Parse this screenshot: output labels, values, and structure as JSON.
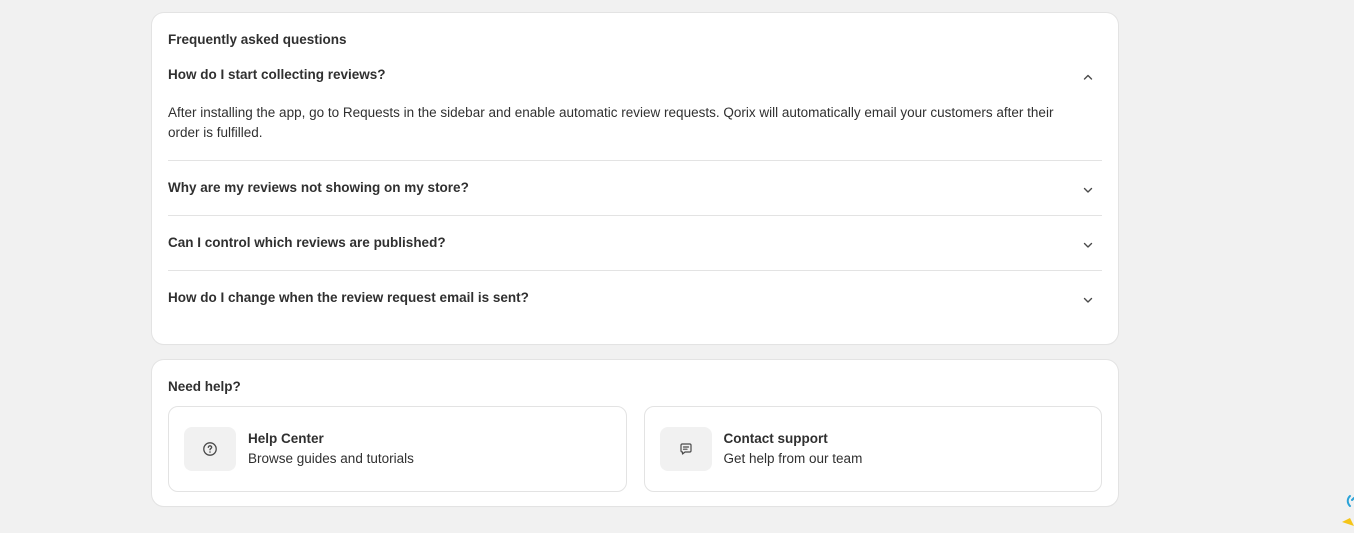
{
  "faq": {
    "title": "Frequently asked questions",
    "items": [
      {
        "question": "How do I start collecting reviews?",
        "answer": "After installing the app, go to Requests in the sidebar and enable automatic review requests. Qorix will automatically email your customers after their order is fulfilled.",
        "expanded": true,
        "icon": "chevron-up-icon"
      },
      {
        "question": "Why are my reviews not showing on my store?",
        "expanded": false,
        "icon": "chevron-down-icon"
      },
      {
        "question": "Can I control which reviews are published?",
        "expanded": false,
        "icon": "chevron-down-icon"
      },
      {
        "question": "How do I change when the review request email is sent?",
        "expanded": false,
        "icon": "chevron-down-icon"
      }
    ]
  },
  "help": {
    "title": "Need help?",
    "tiles": [
      {
        "title": "Help Center",
        "subtitle": "Browse guides and tutorials",
        "icon": "question-circle-icon"
      },
      {
        "title": "Contact support",
        "subtitle": "Get help from our team",
        "icon": "chat-bubble-icon"
      }
    ]
  },
  "colors": {
    "background": "#f1f1f1",
    "card": "#ffffff",
    "text": "#303030",
    "divider": "#e3e3e3",
    "mascot_blue": "#2aa3d8",
    "mascot_yellow": "#f5c518"
  }
}
